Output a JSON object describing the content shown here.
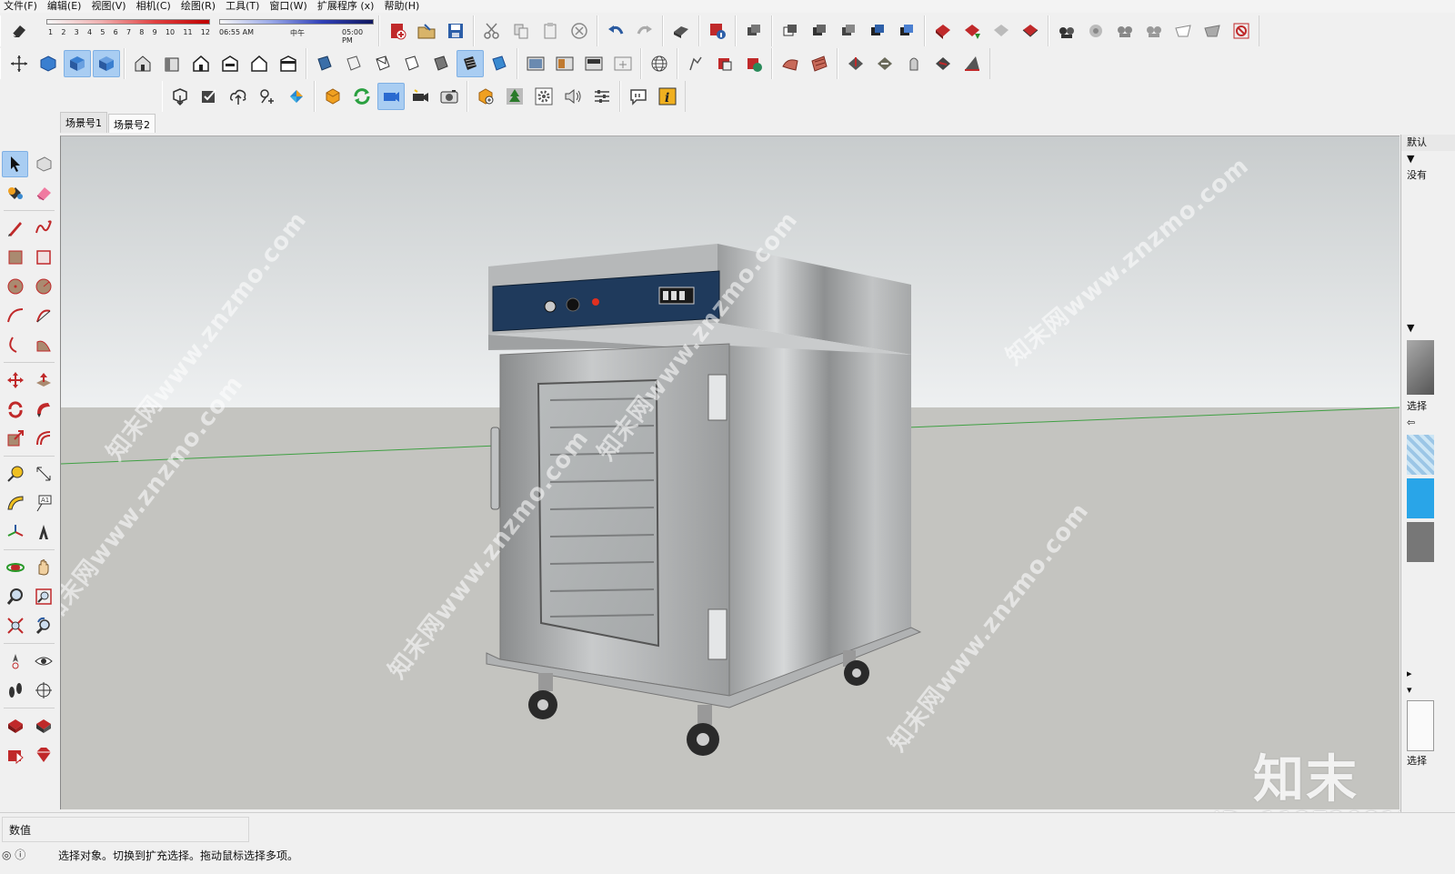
{
  "menu": [
    "文件(F)",
    "编辑(E)",
    "视图(V)",
    "相机(C)",
    "绘图(R)",
    "工具(T)",
    "窗口(W)",
    "扩展程序 (x)",
    "帮助(H)"
  ],
  "shadow": {
    "months": [
      "1",
      "2",
      "3",
      "4",
      "5",
      "6",
      "7",
      "8",
      "9",
      "10",
      "11",
      "12"
    ],
    "time_start": "06:55 AM",
    "time_mid": "中午",
    "time_end": "05:00 PM"
  },
  "scene_tabs": [
    {
      "label": "场景号1",
      "active": false
    },
    {
      "label": "场景号2",
      "active": true
    }
  ],
  "right_tray": {
    "items": [
      "默认",
      "▼",
      "没有",
      "▼",
      "选择",
      "⇦",
      "▸",
      "▾",
      "选择"
    ]
  },
  "measurements": {
    "label": "数值",
    "value": ""
  },
  "status_bar": {
    "hint": "选择对象。切换到扩充选择。拖动鼠标选择多项。"
  },
  "watermarks": {
    "site": "知末网www.znzmo.com",
    "logo": "知末",
    "id": "ID: 1127208177"
  },
  "icons": {
    "toolbar_row1": [
      "eraser-icon",
      "new-file-icon",
      "open-folder-icon",
      "save-icon",
      "cut-icon",
      "copy-icon",
      "paste-icon",
      "delete-icon",
      "undo-icon",
      "redo-icon",
      "print-icon",
      "model-info-icon",
      "component-1-icon",
      "component-2-icon",
      "component-3-icon",
      "component-4-icon",
      "component-5-icon",
      "component-6-icon",
      "warehouse-1-icon",
      "warehouse-2-icon",
      "warehouse-3-icon",
      "warehouse-4-icon",
      "render-1-icon",
      "render-2-icon",
      "render-3-icon",
      "render-4-icon",
      "render-5-icon",
      "render-6-icon",
      "close-red-icon"
    ],
    "toolbar_row2": [
      "axes-icon",
      "iso-view-icon",
      "top-view-icon",
      "front-view-icon",
      "house-1-icon",
      "house-2-icon",
      "house-3-icon",
      "house-4-icon",
      "house-5-icon",
      "house-6-icon",
      "xray-icon",
      "wireframe-icon",
      "hidden-line-icon",
      "shaded-icon",
      "textured-icon",
      "mono-icon",
      "section-1-icon",
      "section-2-icon",
      "section-3-icon",
      "section-4-icon",
      "globe-icon",
      "sandbox-1-icon",
      "sandbox-2-icon",
      "sandbox-3-icon",
      "sandbox-4-icon",
      "sandbox-5-icon",
      "sandbox-6-icon",
      "sandbox-7-icon",
      "sandbox-8-icon",
      "sandbox-9-icon",
      "sandbox-10-icon"
    ],
    "toolbar_row3": [
      "export-icon",
      "check-icon",
      "upload-icon",
      "add-location-icon",
      "ruby-icon",
      "shield-icon",
      "refresh-icon",
      "camera-walk-icon",
      "camera-video-icon",
      "photo-camera-icon",
      "shield-add-icon",
      "tree-icon",
      "settings-icon",
      "sound-icon",
      "sliders-icon",
      "chat-icon",
      "info-icon"
    ],
    "left_toolbar": [
      "select-icon",
      "component-icon",
      "paint-bucket-icon",
      "eraser-icon",
      "pencil-icon",
      "freehand-icon",
      "rectangle-icon",
      "rotated-rect-icon",
      "circle-icon",
      "polygon-icon",
      "arc-icon",
      "arc-2pt-icon",
      "arc-3pt-icon",
      "pie-icon",
      "move-icon",
      "push-pull-icon",
      "rotate-icon",
      "follow-me-icon",
      "scale-icon",
      "offset-icon",
      "tape-measure-icon",
      "dimension-icon",
      "protractor-icon",
      "text-icon",
      "axes-icon",
      "3d-text-icon",
      "orbit-icon",
      "pan-icon",
      "zoom-icon",
      "zoom-window-icon",
      "zoom-extents-icon",
      "previous-view-icon",
      "position-camera-icon",
      "look-around-icon",
      "walk-icon",
      "section-plane-icon",
      "warehouse-icon",
      "extension-icon",
      "share-icon",
      "ruby-icon"
    ]
  }
}
